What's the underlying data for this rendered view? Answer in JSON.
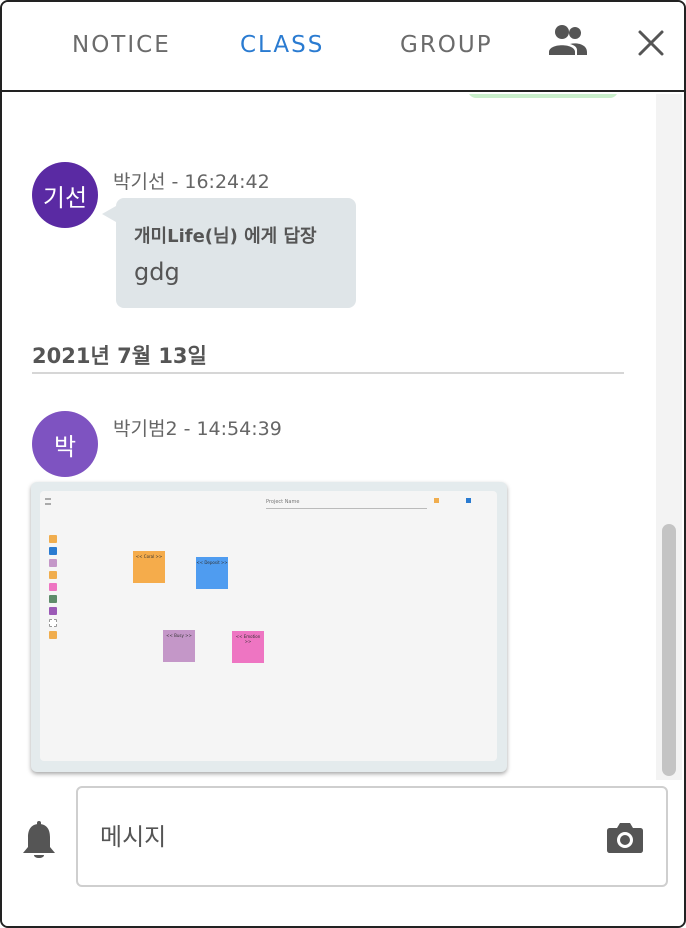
{
  "header": {
    "tabs": [
      {
        "label": "NOTICE",
        "active": false
      },
      {
        "label": "CLASS",
        "active": true
      },
      {
        "label": "GROUP",
        "active": false
      }
    ],
    "icons": [
      "people-icon",
      "close-icon"
    ]
  },
  "chat": {
    "messages": [
      {
        "avatar": "기선",
        "meta": "박기선 - 16:24:42",
        "reply_header": "개미Life(님) 에게 답장",
        "text": "gdg"
      },
      {
        "avatar": "박",
        "meta": "박기범2 - 14:54:39",
        "attachment": {
          "type": "image",
          "project_name": "Project Name",
          "notes": [
            {
              "label": "<< Coral >>",
              "color": "#f5ac4b"
            },
            {
              "label": "<< Deposit >>",
              "color": "#4f9cf0"
            },
            {
              "label": "<< Busy >>",
              "color": "#c497c8"
            },
            {
              "label": "<< Emotion >>",
              "color": "#ee75c2"
            }
          ],
          "palette": [
            "#f0ad4e",
            "#2a7bd1",
            "#c497c8",
            "#f0ad4e",
            "#ee75c2",
            "#5e8c6a",
            "#9b59b6",
            "#f0ad4e"
          ]
        }
      }
    ],
    "date_separator": "2021년 7월 13일"
  },
  "footer": {
    "input_placeholder": "메시지",
    "icons": [
      "bell-icon",
      "camera-icon"
    ]
  },
  "colors": {
    "active_tab": "#2a7bd1",
    "inactive_tab": "#6b6b6b",
    "avatar_1": "#5a2aa3",
    "avatar_2": "#7e53c1",
    "bubble": "#dfe5e8"
  }
}
